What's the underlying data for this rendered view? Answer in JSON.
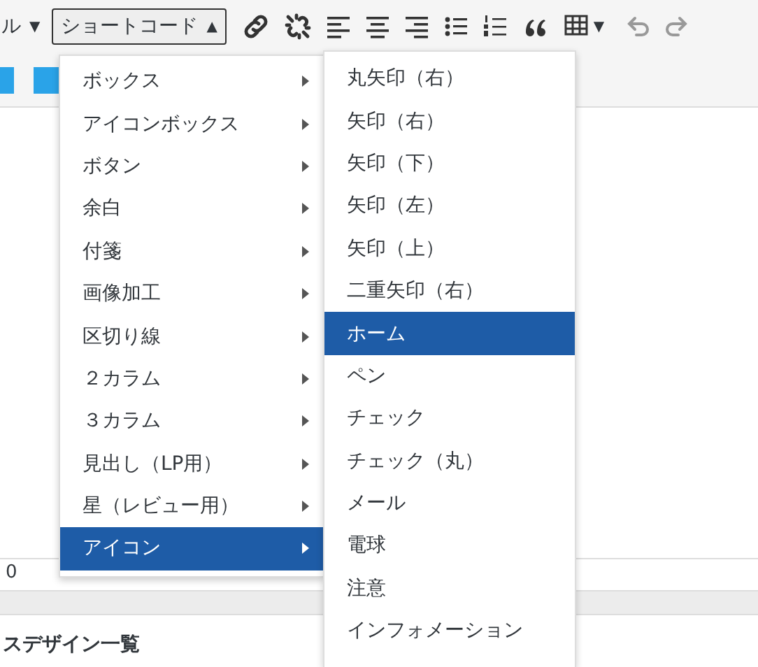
{
  "toolbar": {
    "style_dropdown": {
      "label": "ル",
      "caret": "▼"
    },
    "shortcode_button": {
      "label": "ショートコード",
      "caret": "▲"
    },
    "table_caret": "▼"
  },
  "editor": {
    "counter": "0",
    "heading": "スデザイン一覧"
  },
  "menu": {
    "items": [
      {
        "label": "ボックス",
        "selected": false
      },
      {
        "label": "アイコンボックス",
        "selected": false
      },
      {
        "label": "ボタン",
        "selected": false
      },
      {
        "label": "余白",
        "selected": false
      },
      {
        "label": "付箋",
        "selected": false
      },
      {
        "label": "画像加工",
        "selected": false
      },
      {
        "label": "区切り線",
        "selected": false
      },
      {
        "label": "２カラム",
        "selected": false
      },
      {
        "label": "３カラム",
        "selected": false
      },
      {
        "label": "見出し（LP用）",
        "selected": false
      },
      {
        "label": "星（レビュー用）",
        "selected": false
      },
      {
        "label": "アイコン",
        "selected": true
      }
    ]
  },
  "submenu": {
    "items": [
      {
        "label": "丸矢印（右）",
        "selected": false
      },
      {
        "label": "矢印（右）",
        "selected": false
      },
      {
        "label": "矢印（下）",
        "selected": false
      },
      {
        "label": "矢印（左）",
        "selected": false
      },
      {
        "label": "矢印（上）",
        "selected": false
      },
      {
        "label": "二重矢印（右）",
        "selected": false
      },
      {
        "label": "ホーム",
        "selected": true
      },
      {
        "label": "ペン",
        "selected": false
      },
      {
        "label": "チェック",
        "selected": false
      },
      {
        "label": "チェック（丸）",
        "selected": false
      },
      {
        "label": "メール",
        "selected": false
      },
      {
        "label": "電球",
        "selected": false
      },
      {
        "label": "注意",
        "selected": false
      },
      {
        "label": "インフォメーション",
        "selected": false
      }
    ]
  }
}
